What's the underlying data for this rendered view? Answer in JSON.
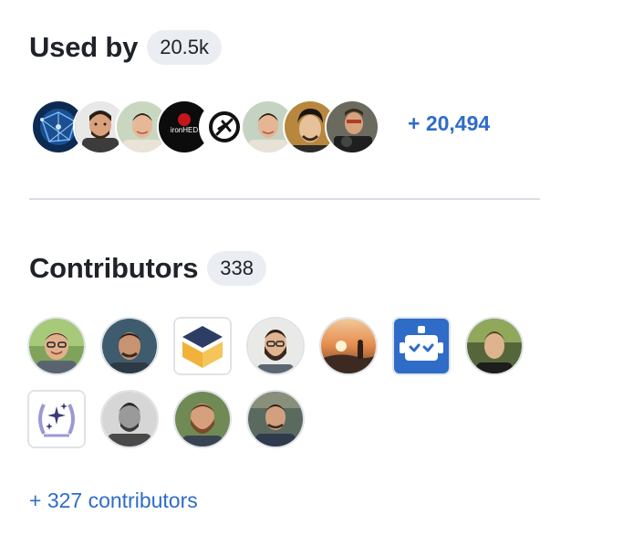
{
  "used_by": {
    "title": "Used by",
    "count": "20.5k",
    "more_label": "+ 20,494",
    "avatars": [
      {
        "icon": "network-art-avatar"
      },
      {
        "icon": "cartoon-man-avatar"
      },
      {
        "icon": "young-man-avatar"
      },
      {
        "icon": "ironhed-logo-avatar"
      },
      {
        "icon": "owasp-logo-avatar"
      },
      {
        "icon": "young-man-avatar-2"
      },
      {
        "icon": "man-portrait-avatar"
      },
      {
        "icon": "man-with-camera-avatar"
      }
    ],
    "ironhed_text": "ironHED"
  },
  "contributors": {
    "title": "Contributors",
    "count": "338",
    "more_label": "+ 327 contributors",
    "avatars": [
      {
        "icon": "man-glasses-avatar"
      },
      {
        "icon": "man-outdoor-avatar"
      },
      {
        "icon": "yellow-box-logo-avatar"
      },
      {
        "icon": "man-beard-glasses-avatar"
      },
      {
        "icon": "sunset-landscape-avatar"
      },
      {
        "icon": "bot-logo-avatar"
      },
      {
        "icon": "young-man-green-avatar"
      },
      {
        "icon": "laurel-stars-logo-avatar"
      },
      {
        "icon": "man-bw-avatar"
      },
      {
        "icon": "man-beard-avatar"
      },
      {
        "icon": "man-street-avatar"
      }
    ]
  },
  "colors": {
    "link": "#2f6cc8",
    "counter_bg": "#eaeef2",
    "divider": "#d8dee4",
    "bot_blue": "#2f6cc8",
    "box_yellow": "#f0b23a",
    "laurel_purple": "#9b98d8"
  }
}
